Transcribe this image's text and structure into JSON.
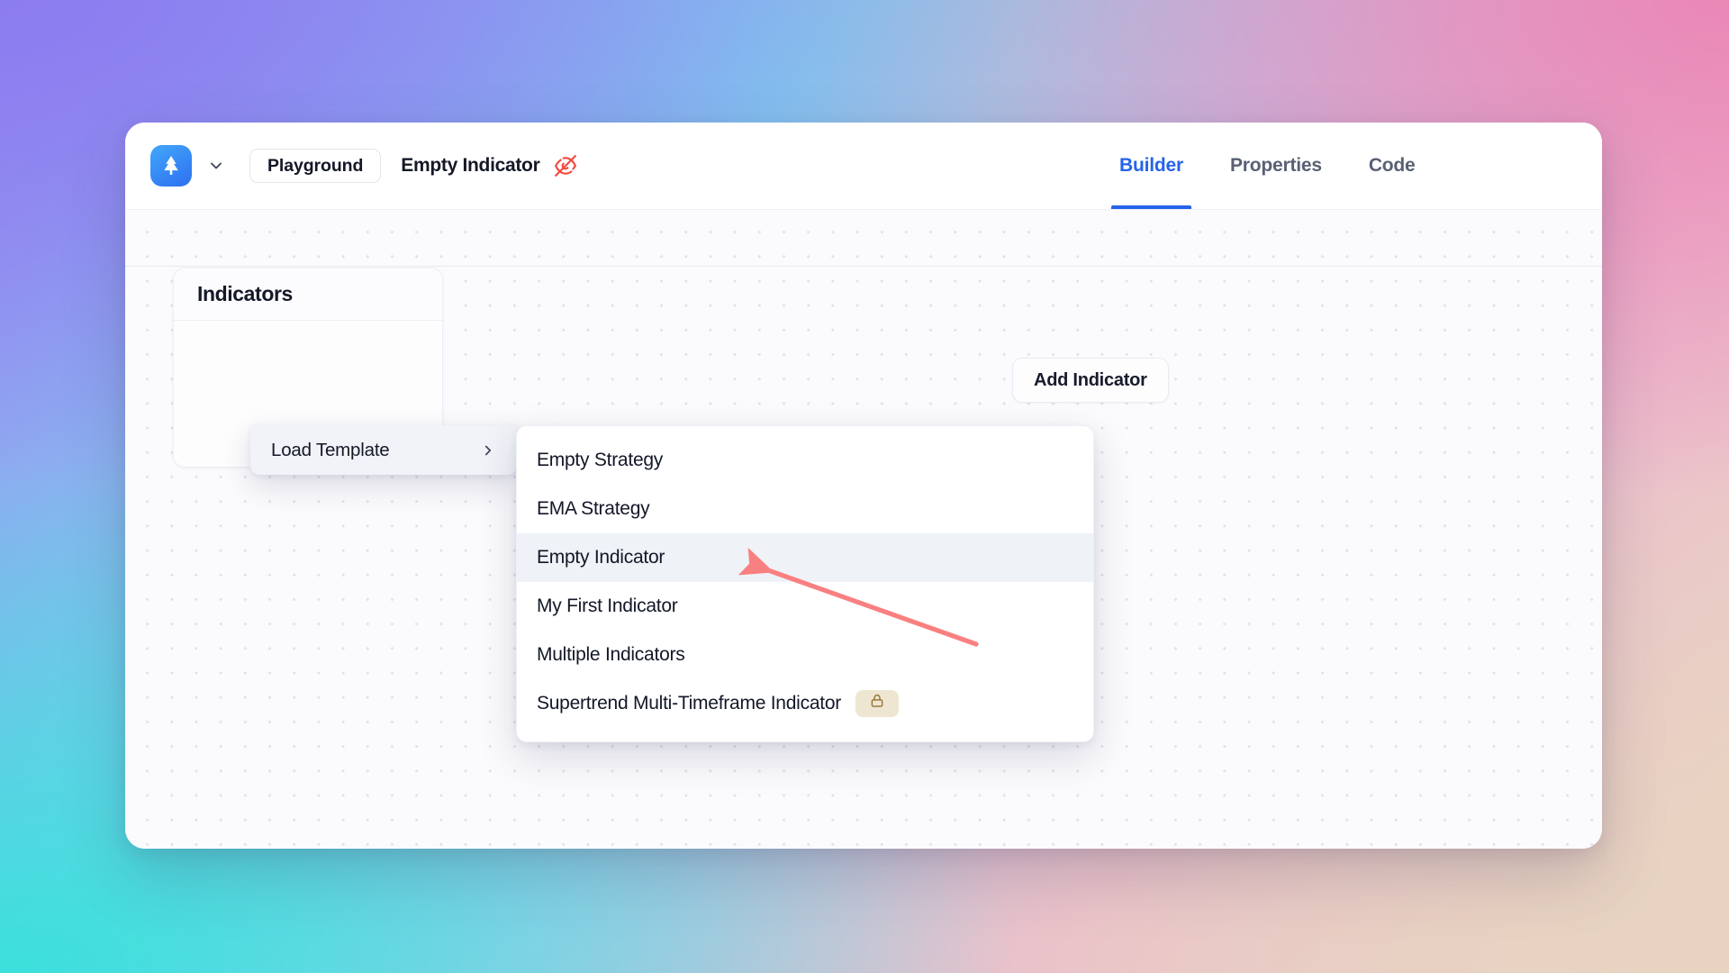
{
  "window": {
    "topbar": {
      "logo_icon": "pine-tree-logo-icon",
      "workspace_chevron_icon": "chevron-down-icon",
      "workspace_label": "Playground",
      "document_title": "Empty Indicator",
      "visibility_icon": "eye-off-icon",
      "accent_color": "#2563eb",
      "visibility_icon_color": "#f4473e"
    },
    "tabs": [
      {
        "label": "Builder",
        "active": true
      },
      {
        "label": "Properties",
        "active": false
      },
      {
        "label": "Code",
        "active": false
      }
    ]
  },
  "canvas": {
    "indicators_card": {
      "title": "Indicators"
    },
    "add_indicator_button": {
      "label": "Add Indicator"
    }
  },
  "context_menu": {
    "items": [
      {
        "label": "Load Template",
        "chevron_icon": "chevron-right-icon",
        "highlighted": true
      }
    ]
  },
  "submenu": {
    "items": [
      {
        "label": "Empty Strategy",
        "highlighted": false,
        "locked": false
      },
      {
        "label": "EMA Strategy",
        "highlighted": false,
        "locked": false
      },
      {
        "label": "Empty Indicator",
        "highlighted": true,
        "locked": false
      },
      {
        "label": "My First Indicator",
        "highlighted": false,
        "locked": false
      },
      {
        "label": "Multiple Indicators",
        "highlighted": false,
        "locked": false
      },
      {
        "label": "Supertrend Multi-Timeframe Indicator",
        "highlighted": false,
        "locked": true,
        "lock_icon": "lock-icon"
      }
    ],
    "lock_badge_bg": "#efe6d2",
    "lock_badge_fg": "#9a7a3c"
  },
  "annotation": {
    "arrow_icon": "pointer-arrow-icon",
    "color": "#f98080",
    "points_to": "Empty Indicator"
  },
  "wallpaper": {
    "corner_top_left": "#8b7cf0",
    "corner_top_right": "#ea87b6",
    "corner_bottom_left": "#3ce0dc",
    "corner_bottom_right": "#e7d3c0"
  }
}
